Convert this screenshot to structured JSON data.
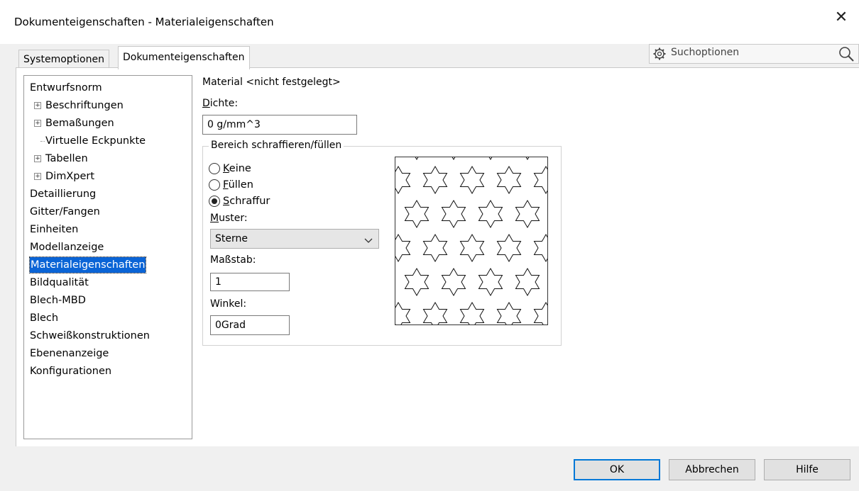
{
  "window": {
    "title": "Dokumenteigenschaften - Materialeigenschaften",
    "close_glyph": "✕"
  },
  "tabs": [
    {
      "label": "Systemoptionen",
      "active": false
    },
    {
      "label": "Dokumenteigenschaften",
      "active": true
    }
  ],
  "search": {
    "placeholder": "Suchoptionen",
    "icon": "gear-icon"
  },
  "tree": {
    "items": [
      {
        "label": "Entwurfsnorm",
        "level": 0
      },
      {
        "label": "Beschriftungen",
        "level": 1,
        "expandable": true
      },
      {
        "label": "Bemaßungen",
        "level": 1,
        "expandable": true
      },
      {
        "label": "Virtuelle Eckpunkte",
        "level": 1,
        "expandable": false
      },
      {
        "label": "Tabellen",
        "level": 1,
        "expandable": true
      },
      {
        "label": "DimXpert",
        "level": 1,
        "expandable": true
      },
      {
        "label": "Detaillierung",
        "level": 0
      },
      {
        "label": "Gitter/Fangen",
        "level": 0
      },
      {
        "label": "Einheiten",
        "level": 0
      },
      {
        "label": "Modellanzeige",
        "level": 0
      },
      {
        "label": "Materialeigenschaften",
        "level": 0,
        "selected": true
      },
      {
        "label": "Bildqualität",
        "level": 0
      },
      {
        "label": "Blech-MBD",
        "level": 0
      },
      {
        "label": "Blech",
        "level": 0
      },
      {
        "label": "Schweißkonstruktionen",
        "level": 0
      },
      {
        "label": "Ebenenanzeige",
        "level": 0
      },
      {
        "label": "Konfigurationen",
        "level": 0
      }
    ]
  },
  "material": {
    "header": "Material <nicht festgelegt>",
    "density_label": "Dichte:",
    "density_value": "0 g/mm^3",
    "group_title": "Bereich schraffieren/füllen",
    "radios": [
      {
        "label": "Keine",
        "checked": false
      },
      {
        "label": "Füllen",
        "checked": false
      },
      {
        "label": "Schraffur",
        "checked": true
      }
    ],
    "pattern_label": "Muster:",
    "pattern_value": "Sterne",
    "scale_label": "Maßstab:",
    "scale_value": "1",
    "angle_label": "Winkel:",
    "angle_value": "0Grad"
  },
  "buttons": {
    "ok": "OK",
    "cancel": "Abbrechen",
    "help": "Hilfe"
  },
  "colors": {
    "selection": "#0a64d6",
    "default_button_border": "#0078d7"
  }
}
